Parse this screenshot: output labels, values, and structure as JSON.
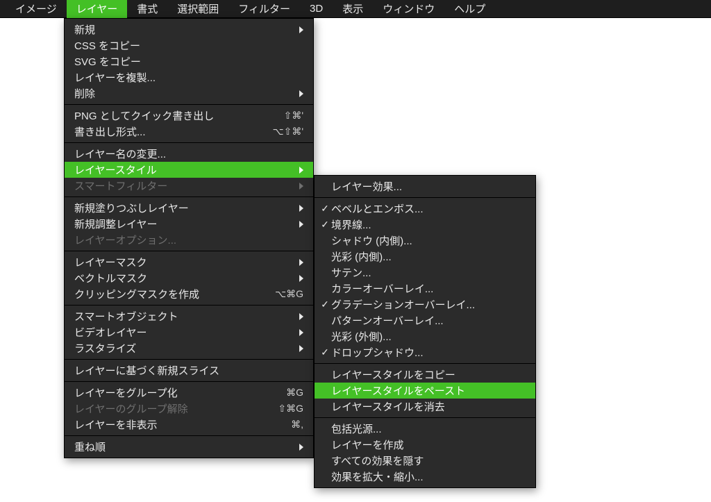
{
  "menubar": {
    "items": [
      {
        "label": "イメージ",
        "active": false
      },
      {
        "label": "レイヤー",
        "active": true
      },
      {
        "label": "書式",
        "active": false
      },
      {
        "label": "選択範囲",
        "active": false
      },
      {
        "label": "フィルター",
        "active": false
      },
      {
        "label": "3D",
        "active": false
      },
      {
        "label": "表示",
        "active": false
      },
      {
        "label": "ウィンドウ",
        "active": false
      },
      {
        "label": "ヘルプ",
        "active": false
      }
    ]
  },
  "dropdown": {
    "groups": [
      [
        {
          "label": "新規",
          "submenu": true
        },
        {
          "label": "CSS をコピー"
        },
        {
          "label": "SVG をコピー"
        },
        {
          "label": "レイヤーを複製..."
        },
        {
          "label": "削除",
          "submenu": true
        }
      ],
      [
        {
          "label": "PNG としてクイック書き出し",
          "shortcut": "⇧⌘'"
        },
        {
          "label": "書き出し形式...",
          "shortcut": "⌥⇧⌘'"
        }
      ],
      [
        {
          "label": "レイヤー名の変更..."
        },
        {
          "label": "レイヤースタイル",
          "submenu": true,
          "highlight": true
        },
        {
          "label": "スマートフィルター",
          "submenu": true,
          "disabled": true
        }
      ],
      [
        {
          "label": "新規塗りつぶしレイヤー",
          "submenu": true
        },
        {
          "label": "新規調整レイヤー",
          "submenu": true
        },
        {
          "label": "レイヤーオプション...",
          "disabled": true
        }
      ],
      [
        {
          "label": "レイヤーマスク",
          "submenu": true
        },
        {
          "label": "ベクトルマスク",
          "submenu": true
        },
        {
          "label": "クリッピングマスクを作成",
          "shortcut": "⌥⌘G"
        }
      ],
      [
        {
          "label": "スマートオブジェクト",
          "submenu": true
        },
        {
          "label": "ビデオレイヤー",
          "submenu": true
        },
        {
          "label": "ラスタライズ",
          "submenu": true
        }
      ],
      [
        {
          "label": "レイヤーに基づく新規スライス"
        }
      ],
      [
        {
          "label": "レイヤーをグループ化",
          "shortcut": "⌘G"
        },
        {
          "label": "レイヤーのグループ解除",
          "shortcut": "⇧⌘G",
          "disabled": true
        },
        {
          "label": "レイヤーを非表示",
          "shortcut": "⌘,"
        }
      ],
      [
        {
          "label": "重ね順",
          "submenu": true
        }
      ]
    ]
  },
  "submenu": {
    "groups": [
      [
        {
          "label": "レイヤー効果..."
        }
      ],
      [
        {
          "label": "ベベルとエンボス...",
          "checked": true
        },
        {
          "label": "境界線...",
          "checked": true
        },
        {
          "label": "シャドウ (内側)..."
        },
        {
          "label": "光彩 (内側)..."
        },
        {
          "label": "サテン..."
        },
        {
          "label": "カラーオーバーレイ..."
        },
        {
          "label": "グラデーションオーバーレイ...",
          "checked": true
        },
        {
          "label": "パターンオーバーレイ..."
        },
        {
          "label": "光彩 (外側)..."
        },
        {
          "label": "ドロップシャドウ...",
          "checked": true
        }
      ],
      [
        {
          "label": "レイヤースタイルをコピー"
        },
        {
          "label": "レイヤースタイルをペースト",
          "highlight": true
        },
        {
          "label": "レイヤースタイルを消去"
        }
      ],
      [
        {
          "label": "包括光源..."
        },
        {
          "label": "レイヤーを作成"
        },
        {
          "label": "すべての効果を隠す"
        },
        {
          "label": "効果を拡大・縮小..."
        }
      ]
    ]
  }
}
